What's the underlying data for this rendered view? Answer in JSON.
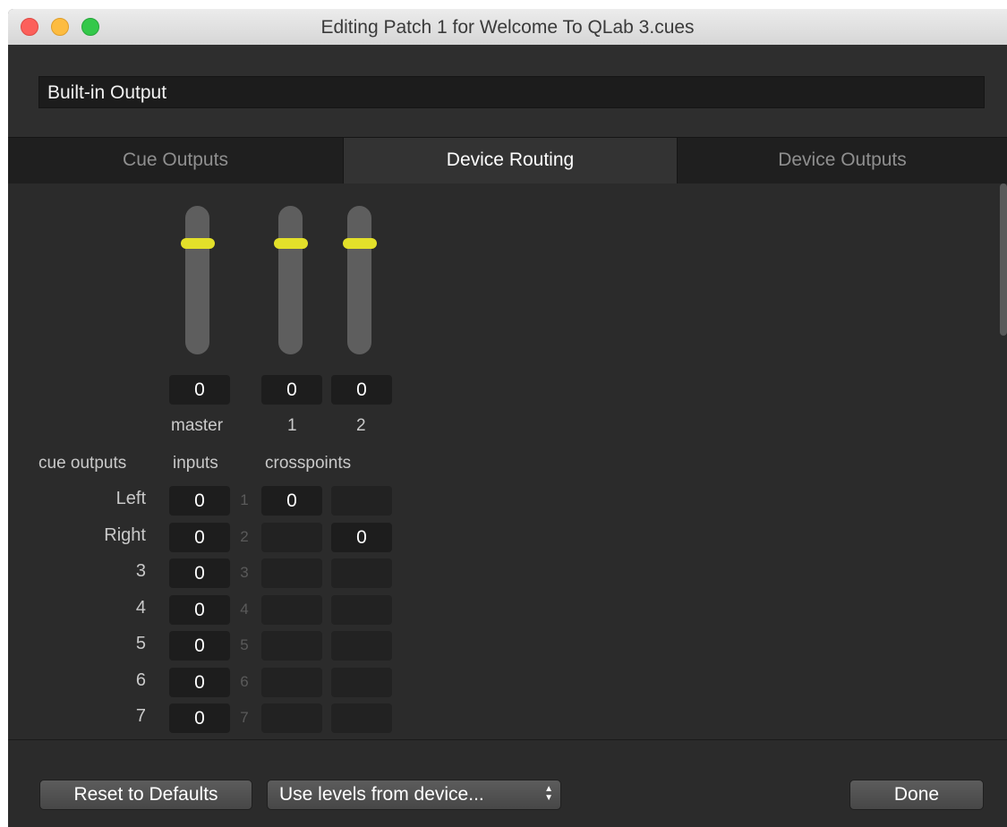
{
  "window": {
    "title": "Editing Patch 1 for Welcome To QLab 3.cues"
  },
  "device_name": "Built-in Output",
  "tabs": [
    {
      "label": "Cue Outputs",
      "selected": false
    },
    {
      "label": "Device Routing",
      "selected": true
    },
    {
      "label": "Device Outputs",
      "selected": false
    }
  ],
  "sliders": [
    {
      "label": "master",
      "value": "0"
    },
    {
      "label": "1",
      "value": "0"
    },
    {
      "label": "2",
      "value": "0"
    }
  ],
  "headers": {
    "cue_outputs": "cue outputs",
    "inputs": "inputs",
    "crosspoints": "crosspoints"
  },
  "rows": [
    {
      "label": "Left",
      "input": "0",
      "num": "1",
      "cross1": "0",
      "cross2": ""
    },
    {
      "label": "Right",
      "input": "0",
      "num": "2",
      "cross1": "",
      "cross2": "0"
    },
    {
      "label": "3",
      "input": "0",
      "num": "3",
      "cross1": "",
      "cross2": ""
    },
    {
      "label": "4",
      "input": "0",
      "num": "4",
      "cross1": "",
      "cross2": ""
    },
    {
      "label": "5",
      "input": "0",
      "num": "5",
      "cross1": "",
      "cross2": ""
    },
    {
      "label": "6",
      "input": "0",
      "num": "6",
      "cross1": "",
      "cross2": ""
    },
    {
      "label": "7",
      "input": "0",
      "num": "7",
      "cross1": "",
      "cross2": ""
    }
  ],
  "buttons": {
    "reset": "Reset to Defaults",
    "levels_select": "Use levels from device...",
    "done": "Done"
  },
  "colors": {
    "slider_thumb": "#e3e02a",
    "background": "#2b2b2b"
  }
}
